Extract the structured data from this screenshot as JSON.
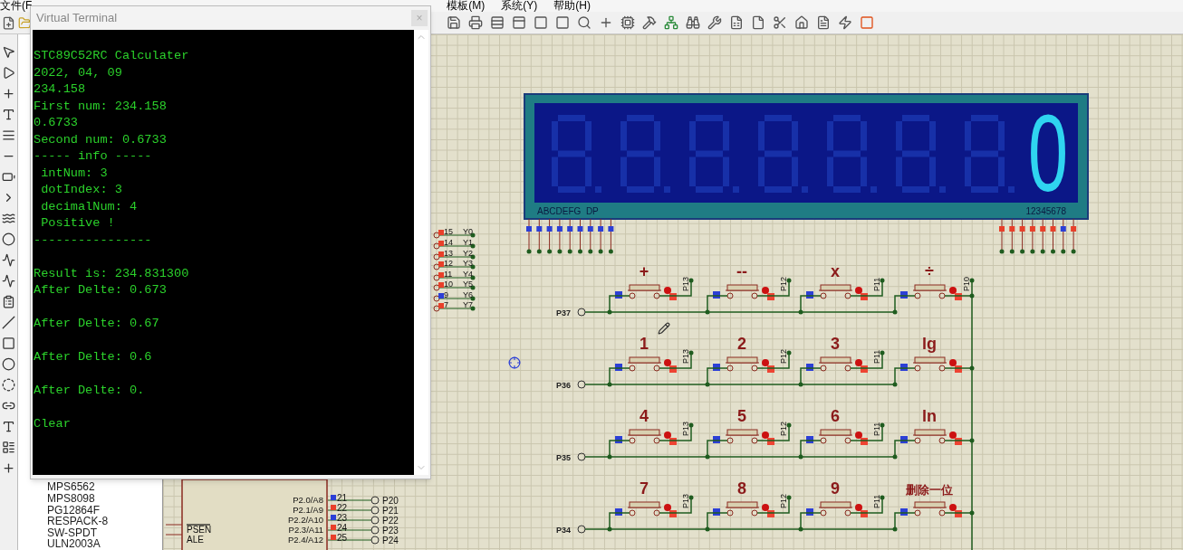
{
  "menu_bar": [
    {
      "label": "文件(F"
    },
    {
      "label": "模板(M)"
    },
    {
      "label": "系统(Y)"
    },
    {
      "label": "帮助(H)"
    }
  ],
  "device_list": [
    "MPS6562",
    "MPS8098",
    "PG12864F",
    "RESPACK-8",
    "SW-SPDT",
    "ULN2003A"
  ],
  "display": {
    "reading": "0",
    "segment_labels": "ABCDEFG  DP",
    "digit_labels": "12345678"
  },
  "port_pins": [
    {
      "number": "15",
      "net": "Y0",
      "high": true
    },
    {
      "number": "14",
      "net": "Y1",
      "high": true
    },
    {
      "number": "13",
      "net": "Y2",
      "high": true
    },
    {
      "number": "12",
      "net": "Y3",
      "high": true
    },
    {
      "number": "11",
      "net": "Y4",
      "high": true
    },
    {
      "number": "10",
      "net": "Y5",
      "high": true
    },
    {
      "number": "9",
      "net": "Y6",
      "high": false
    },
    {
      "number": "7",
      "net": "Y7",
      "high": true
    }
  ],
  "keypad": {
    "rows": [
      {
        "net": "P37",
        "keys": [
          {
            "label": "+",
            "pin": "P13",
            "pressed": false
          },
          {
            "label": "--",
            "pin": "P12",
            "pressed": false
          },
          {
            "label": "x",
            "pin": "P11",
            "pressed": false
          },
          {
            "label": "÷",
            "pin": "P10",
            "pressed": false
          }
        ]
      },
      {
        "net": "P36",
        "keys": [
          {
            "label": "1",
            "pin": "P13",
            "pressed": false
          },
          {
            "label": "2",
            "pin": "P12",
            "pressed": false
          },
          {
            "label": "3",
            "pin": "P11",
            "pressed": false
          },
          {
            "label": "lg",
            "pressed": false
          }
        ]
      },
      {
        "net": "P35",
        "keys": [
          {
            "label": "4",
            "pin": "P13",
            "pressed": false
          },
          {
            "label": "5",
            "pin": "P12",
            "pressed": false
          },
          {
            "label": "6",
            "pin": "P11",
            "pressed": false
          },
          {
            "label": "ln",
            "pressed": false
          }
        ]
      },
      {
        "net": "P34",
        "keys": [
          {
            "label": "7",
            "pin": "P13",
            "pressed": false
          },
          {
            "label": "8",
            "pin": "P12",
            "pressed": false
          },
          {
            "label": "9",
            "pin": "P11",
            "pressed": false
          },
          {
            "label": "删除一位",
            "pressed": false
          }
        ]
      }
    ]
  },
  "mcu": {
    "left_pins": [
      {
        "name": "PSEN",
        "inverted": true
      },
      {
        "name": "ALE",
        "inverted": false
      }
    ],
    "pins": [
      {
        "name": "P2.0/A8",
        "number": "21",
        "net": "P20",
        "high": false
      },
      {
        "name": "P2.1/A9",
        "number": "22",
        "net": "P21",
        "high": true
      },
      {
        "name": "P2.2/A10",
        "number": "23",
        "net": "P22",
        "high": false
      },
      {
        "name": "P2.3/A11",
        "number": "24",
        "net": "P23",
        "high": true
      },
      {
        "name": "P2.4/A12",
        "number": "25",
        "net": "P24",
        "high": true
      }
    ]
  },
  "terminal": {
    "title": "Virtual Terminal",
    "close": "×",
    "paragraphs": [
      [
        "STC89C52RC Calculater",
        "2022, 04, 09",
        "234.158",
        "First num: 234.158",
        "0.6733",
        "Second num: 0.6733",
        "----- info -----",
        " intNum: 3",
        " dotIndex: 3",
        " decimalNum: 4",
        " Positive !",
        "----------------"
      ],
      [
        "Result is: 234.831300",
        "After Delte: 0.673"
      ],
      [
        "After Delte: 0.67"
      ],
      [
        "After Delte: 0.6"
      ],
      [
        "After Delte: 0."
      ],
      [
        "Clear"
      ]
    ]
  }
}
